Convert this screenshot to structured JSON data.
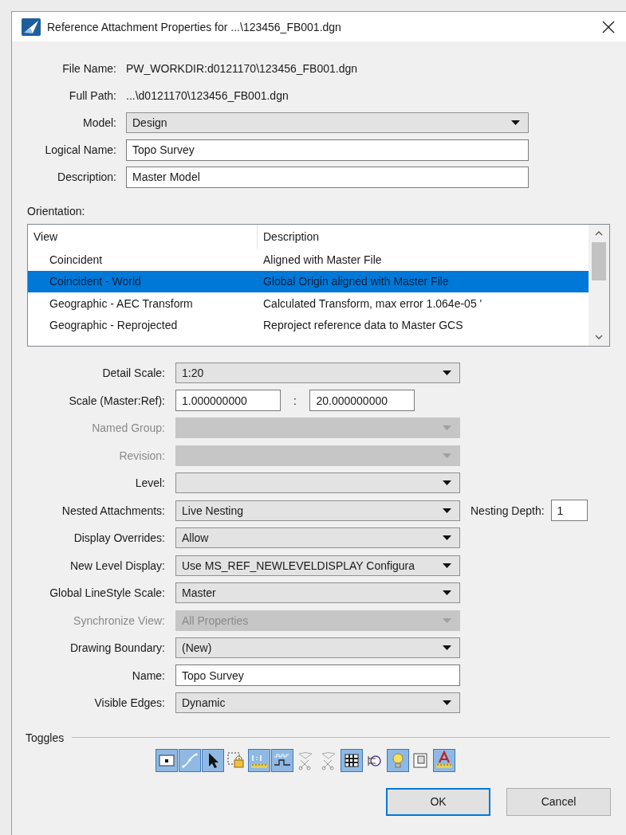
{
  "window": {
    "title": "Reference Attachment Properties for ...\\123456_FB001.dgn"
  },
  "file_info": [
    {
      "label": "File Name:",
      "value": "PW_WORKDIR:d0121170\\123456_FB001.dgn"
    },
    {
      "label": "Full Path:",
      "value": "...\\d0121170\\123456_FB001.dgn"
    }
  ],
  "top_fields": [
    {
      "label": "Model:",
      "kind": "dropdown",
      "value": "Design",
      "disabled": false
    },
    {
      "label": "Logical Name:",
      "kind": "input",
      "value": "Topo Survey",
      "disabled": false
    },
    {
      "label": "Description:",
      "kind": "input",
      "value": "Master Model",
      "disabled": false
    }
  ],
  "orientation": {
    "label": "Orientation:",
    "columns": [
      "View",
      "Description"
    ],
    "rows": [
      {
        "view": "Coincident",
        "description": "Aligned with Master File",
        "selected": false
      },
      {
        "view": "Coincident - World",
        "description": "Global Origin aligned with Master File",
        "selected": true
      },
      {
        "view": "Geographic - AEC Transform",
        "description": "Calculated Transform, max error 1.064e-05 '",
        "selected": false
      },
      {
        "view": "Geographic - Reprojected",
        "description": "Reproject reference data to Master GCS",
        "selected": false
      }
    ]
  },
  "properties": [
    {
      "label": "Detail Scale:",
      "kind": "dropdown",
      "value": "1:20",
      "disabled": false
    },
    {
      "label": "Scale (Master:Ref):",
      "kind": "ratio",
      "values": [
        "1.000000000",
        "20.000000000"
      ],
      "separator": ":",
      "disabled": false
    },
    {
      "label": "Named Group:",
      "kind": "dropdown",
      "disabled": true
    },
    {
      "label": "Revision:",
      "kind": "dropdown",
      "disabled": true
    },
    {
      "label": "Level:",
      "kind": "dropdown",
      "disabled": false
    },
    {
      "label": "Nested Attachments:",
      "kind": "dropdown",
      "value": "Live Nesting",
      "disabled": false,
      "extra": {
        "label": "Nesting Depth:",
        "value": "1"
      }
    },
    {
      "label": "Display Overrides:",
      "kind": "dropdown",
      "value": "Allow",
      "disabled": false
    },
    {
      "label": "New Level Display:",
      "kind": "dropdown",
      "value": "Use MS_REF_NEWLEVELDISPLAY Configura",
      "disabled": false
    },
    {
      "label": "Global LineStyle Scale:",
      "kind": "dropdown",
      "value": "Master",
      "disabled": false
    },
    {
      "label": "Synchronize View:",
      "kind": "dropdown",
      "value": "All Properties",
      "disabled": true
    },
    {
      "label": "Drawing Boundary:",
      "kind": "dropdown",
      "value": "(New)",
      "disabled": false
    },
    {
      "label": "Name:",
      "kind": "input",
      "value": "Topo Survey",
      "disabled": false
    },
    {
      "label": "Visible Edges:",
      "kind": "dropdown",
      "value": "Dynamic",
      "disabled": false
    }
  ],
  "toggles": {
    "label": "Toggles",
    "items": [
      {
        "kind": "display",
        "on": true
      },
      {
        "kind": "snap",
        "on": true
      },
      {
        "kind": "locate",
        "on": true
      },
      {
        "kind": "lock",
        "on": false
      },
      {
        "kind": "scale",
        "on": true
      },
      {
        "kind": "linestyle",
        "on": true
      },
      {
        "kind": "clip-back",
        "on": false
      },
      {
        "kind": "clip-front",
        "on": false
      },
      {
        "kind": "grid",
        "on": true
      },
      {
        "kind": "levels",
        "on": false
      },
      {
        "kind": "light",
        "on": true
      },
      {
        "kind": "page",
        "on": false
      },
      {
        "kind": "annotation",
        "on": true
      }
    ]
  },
  "buttons": [
    {
      "label": "OK",
      "default": true
    },
    {
      "label": "Cancel",
      "default": false
    }
  ]
}
